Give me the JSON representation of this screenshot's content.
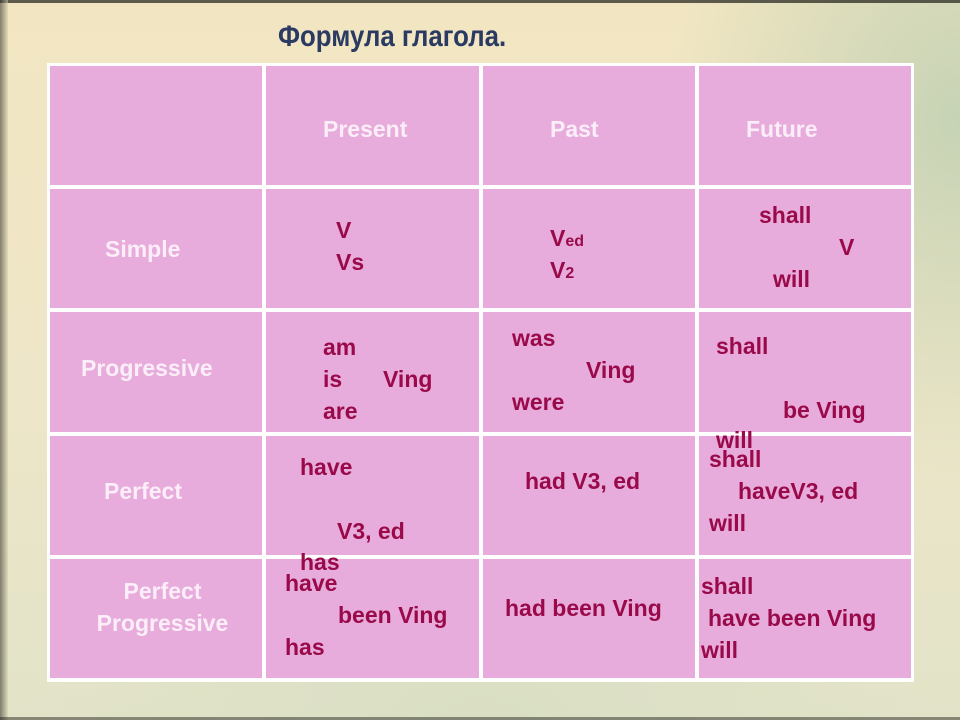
{
  "title": "Формула глагола.",
  "colors": {
    "cell_background": "#e7acdb",
    "header_text": "#fbeef8",
    "formula_text": "#9a0a4a",
    "title_text": "#2b3a63",
    "grid_lines": "#ffffff"
  },
  "table": {
    "columns": [
      "",
      "Present",
      "Past",
      "Future"
    ],
    "rows": [
      {
        "label": "Simple",
        "present": {
          "line1": "V",
          "line2": "Vs"
        },
        "past": {
          "line1_main": "V",
          "line1_sub": "ed",
          "line2_main": "V",
          "line2_sub": "2"
        },
        "future": {
          "line1": "shall",
          "line2": "V",
          "line3": "will"
        }
      },
      {
        "label": "Progressive",
        "present": {
          "line1": "am",
          "line2": "is",
          "line3": "are",
          "suffix": "Ving"
        },
        "past": {
          "line1": "was",
          "suffix": "Ving",
          "line2": "were"
        },
        "future": {
          "line1": "shall",
          "suffix": "be Ving",
          "line2": "will"
        }
      },
      {
        "label": "Perfect",
        "present": {
          "line1": "have",
          "suffix": "V3, ed",
          "line2": "has"
        },
        "past": {
          "text": "had V3, ed"
        },
        "future": {
          "line1": "shall",
          "suffix": "haveV3, ed",
          "line2": "will"
        }
      },
      {
        "label_line1": "Perfect",
        "label_line2": "Progressive",
        "present": {
          "line1": "have",
          "suffix": "been Ving",
          "line2": "has"
        },
        "past": {
          "text": "had been Ving"
        },
        "future": {
          "line1": "shall",
          "suffix": "have been Ving",
          "line2": "will"
        }
      }
    ]
  }
}
